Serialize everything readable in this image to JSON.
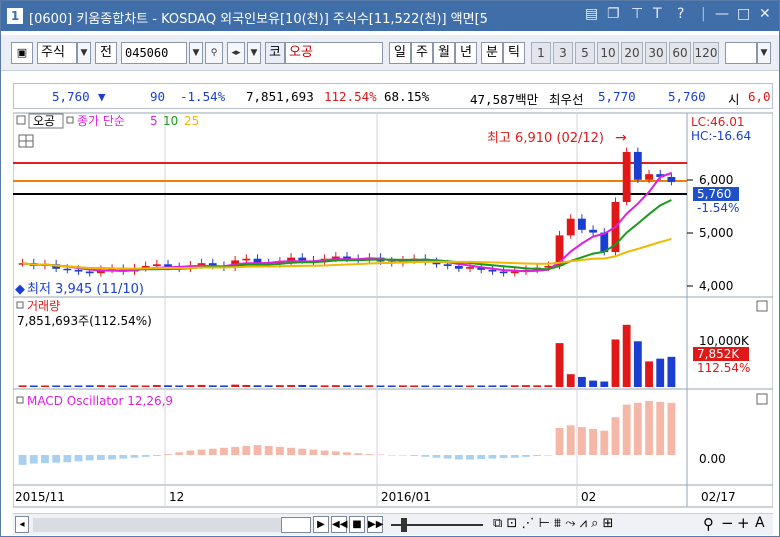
{
  "titlebar": {
    "window_number": "1",
    "title": "[0600] 키움종합차트 - KOSDAQ 외국인보유[10(천)] 주식수[11,522(천)] 액면[5"
  },
  "toolbar": {
    "market_label": "주식",
    "prev_label": "전",
    "code": "045060",
    "market_badge": "코",
    "stock_name": "오공",
    "periods": [
      "일",
      "주",
      "월",
      "년",
      "분",
      "틱"
    ],
    "active_period": "일",
    "numbers": [
      "1",
      "3",
      "5",
      "10",
      "20",
      "30",
      "60",
      "120"
    ]
  },
  "quote": {
    "price": "5,760",
    "change_arrow": "▼",
    "change": "90",
    "change_pct": "-1.54%",
    "volume": "7,851,693",
    "volume_pct": "112.54%",
    "turnover": "68.15%",
    "amount": "47,587백만",
    "best_ask_label": "최우선",
    "best_ask": "5,770",
    "best_bid": "5,760",
    "open_label": "시",
    "open": "6,0"
  },
  "price_panel": {
    "tab_name": "오공",
    "indicator_label": "종가 단순",
    "ma_periods": [
      "5",
      "10",
      "25"
    ],
    "lc_label": "LC:46.01",
    "hc_label": "HC:-16.64",
    "high_annotation": "최고 6,910 (02/12)",
    "low_annotation": "최저 3,945 (11/10)",
    "axis_ticks": [
      "6,000",
      "5,000",
      "4,000"
    ],
    "current_price_label": "5,760",
    "current_change_label": "-1.54%"
  },
  "volume_panel": {
    "title": "거래량",
    "value_text": "7,851,693주(112.54%)",
    "axis_tick": "10,000K",
    "current_label": "7,852K",
    "current_pct": "112.54%"
  },
  "macd_panel": {
    "title": "MACD Oscillator 12,26,9",
    "axis_tick": "0.00"
  },
  "x_axis": {
    "labels": [
      "2015/11",
      "12",
      "2016/01",
      "02",
      "02/17"
    ]
  },
  "colors": {
    "up": "#e01818",
    "down": "#1a3fd0",
    "ma5": "#e020e0",
    "ma10": "#1a9a1a",
    "ma25": "#f0b800",
    "macd": "#f5b8a8",
    "macd_neg": "#a8d0f0",
    "title_bg": "#3f6ea8"
  },
  "chart_data": {
    "type": "candlestick",
    "title": "",
    "x": [
      "2015/11",
      "12",
      "2016/01",
      "02",
      "02/17"
    ],
    "y_ticks": [
      4000,
      5000,
      6000
    ],
    "ylim": [
      3800,
      7000
    ],
    "annotations": [
      {
        "text": "최고 6,910 (02/12)",
        "value": 6910
      },
      {
        "text": "최저 3,945 (11/10)",
        "value": 3945
      }
    ],
    "close_series": [
      4300,
      4250,
      4280,
      4200,
      4180,
      4150,
      4120,
      4180,
      4200,
      4150,
      4210,
      4250,
      4280,
      4230,
      4200,
      4260,
      4300,
      4250,
      4220,
      4350,
      4380,
      4300,
      4280,
      4330,
      4400,
      4350,
      4320,
      4380,
      4420,
      4380,
      4360,
      4400,
      4330,
      4300,
      4350,
      4380,
      4320,
      4280,
      4250,
      4200,
      4230,
      4180,
      4150,
      4120,
      4150,
      4180,
      4220,
      4250,
      4800,
      5100,
      4900,
      4850,
      4500,
      5400,
      6300,
      5800,
      5900,
      5850,
      5760
    ],
    "volume_kilo": [
      180,
      150,
      160,
      140,
      150,
      160,
      180,
      200,
      170,
      160,
      180,
      150,
      210,
      190,
      170,
      200,
      230,
      180,
      170,
      260,
      220,
      190,
      180,
      200,
      210,
      220,
      190,
      180,
      200,
      180,
      170,
      190,
      160,
      150,
      180,
      170,
      160,
      150,
      170,
      180,
      160,
      150,
      170,
      180,
      190,
      200,
      180,
      190,
      4800,
      1400,
      1100,
      700,
      600,
      5200,
      6800,
      5000,
      2800,
      3100,
      3300
    ],
    "macd_osc": [
      -110,
      -95,
      -90,
      -85,
      -80,
      -70,
      -60,
      -55,
      -50,
      -40,
      -30,
      -20,
      -10,
      10,
      30,
      50,
      60,
      70,
      80,
      90,
      100,
      110,
      100,
      90,
      80,
      70,
      60,
      50,
      40,
      30,
      20,
      10,
      5,
      0,
      -5,
      -10,
      -20,
      -30,
      -40,
      -50,
      -50,
      -45,
      -40,
      -35,
      -30,
      -20,
      -10,
      0,
      300,
      330,
      310,
      290,
      270,
      420,
      560,
      580,
      600,
      590,
      580
    ]
  }
}
